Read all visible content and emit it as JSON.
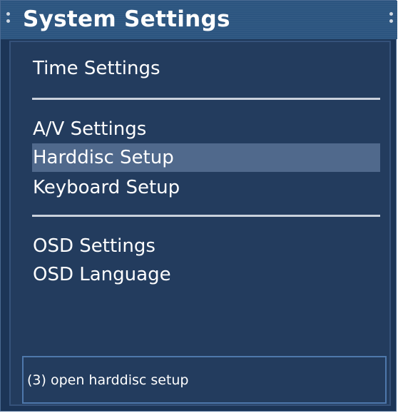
{
  "window": {
    "title": "System Settings",
    "background_color": "#1c3557",
    "title_bar_color": "#2c5580",
    "selection_color": "#50698c"
  },
  "menu": {
    "items": [
      {
        "label": "Time Settings",
        "selected": false
      },
      {
        "label": "A/V Settings",
        "selected": false
      },
      {
        "label": "Harddisc Setup",
        "selected": true
      },
      {
        "label": "Keyboard Setup",
        "selected": false
      },
      {
        "label": "OSD Settings",
        "selected": false
      },
      {
        "label": "OSD Language",
        "selected": false
      }
    ]
  },
  "status": {
    "text": "(3) open harddisc setup"
  }
}
